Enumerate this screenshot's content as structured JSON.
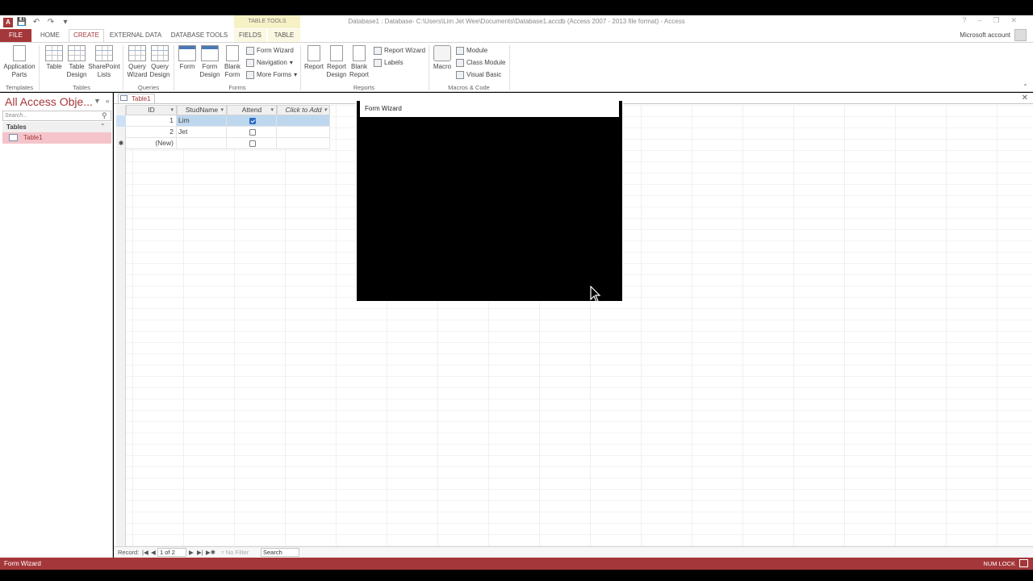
{
  "window": {
    "title": "Database1 : Database- C:\\Users\\Lim Jet Wee\\Documents\\Database1.accdb (Access 2007 - 2013 file format) - Access",
    "app_logo": "A",
    "controls": [
      "?",
      "–",
      "❐",
      "✕"
    ]
  },
  "qat": {
    "save_icon": "save-icon",
    "undo_icon": "undo-icon",
    "redo_icon": "redo-icon"
  },
  "ribbon": {
    "context_header": "TABLE TOOLS",
    "tabs": [
      "FILE",
      "HOME",
      "CREATE",
      "EXTERNAL DATA",
      "DATABASE TOOLS",
      "FIELDS",
      "TABLE"
    ],
    "active_tab": "CREATE",
    "account": "Microsoft account",
    "groups": {
      "templates": {
        "label": "Templates",
        "application_parts": "Application Parts"
      },
      "tables": {
        "label": "Tables",
        "table": "Table",
        "table_design": "Table Design",
        "sharepoint_lists": "SharePoint Lists"
      },
      "queries": {
        "label": "Queries",
        "query_wizard": "Query Wizard",
        "query_design": "Query Design"
      },
      "forms": {
        "label": "Forms",
        "form": "Form",
        "form_design": "Form Design",
        "blank_form": "Blank Form",
        "form_wizard": "Form Wizard",
        "navigation": "Navigation",
        "more_forms": "More Forms"
      },
      "reports": {
        "label": "Reports",
        "report": "Report",
        "report_design": "Report Design",
        "blank_report": "Blank Report",
        "report_wizard": "Report Wizard",
        "labels": "Labels"
      },
      "macros": {
        "label": "Macros & Code",
        "macro": "Macro",
        "module": "Module",
        "class_module": "Class Module",
        "visual_basic": "Visual Basic"
      }
    }
  },
  "nav": {
    "title": "All Access Obje...",
    "search_placeholder": "Search...",
    "group": "Tables",
    "items": [
      "Table1"
    ]
  },
  "document": {
    "tab": "Table1",
    "columns": [
      "ID",
      "StudName",
      "Attend",
      "Click to Add"
    ],
    "rows": [
      {
        "id": "1",
        "name": "Lim",
        "attend": true
      },
      {
        "id": "2",
        "name": "Jet",
        "attend": false
      }
    ],
    "new_row_label": "(New)"
  },
  "wizard": {
    "title": "Form Wizard"
  },
  "record_nav": {
    "record_label": "Record:",
    "position": "1 of 2",
    "filter": "No Filter",
    "search": "Search"
  },
  "status": {
    "left": "Form Wizard",
    "right": "NUM LOCK"
  }
}
